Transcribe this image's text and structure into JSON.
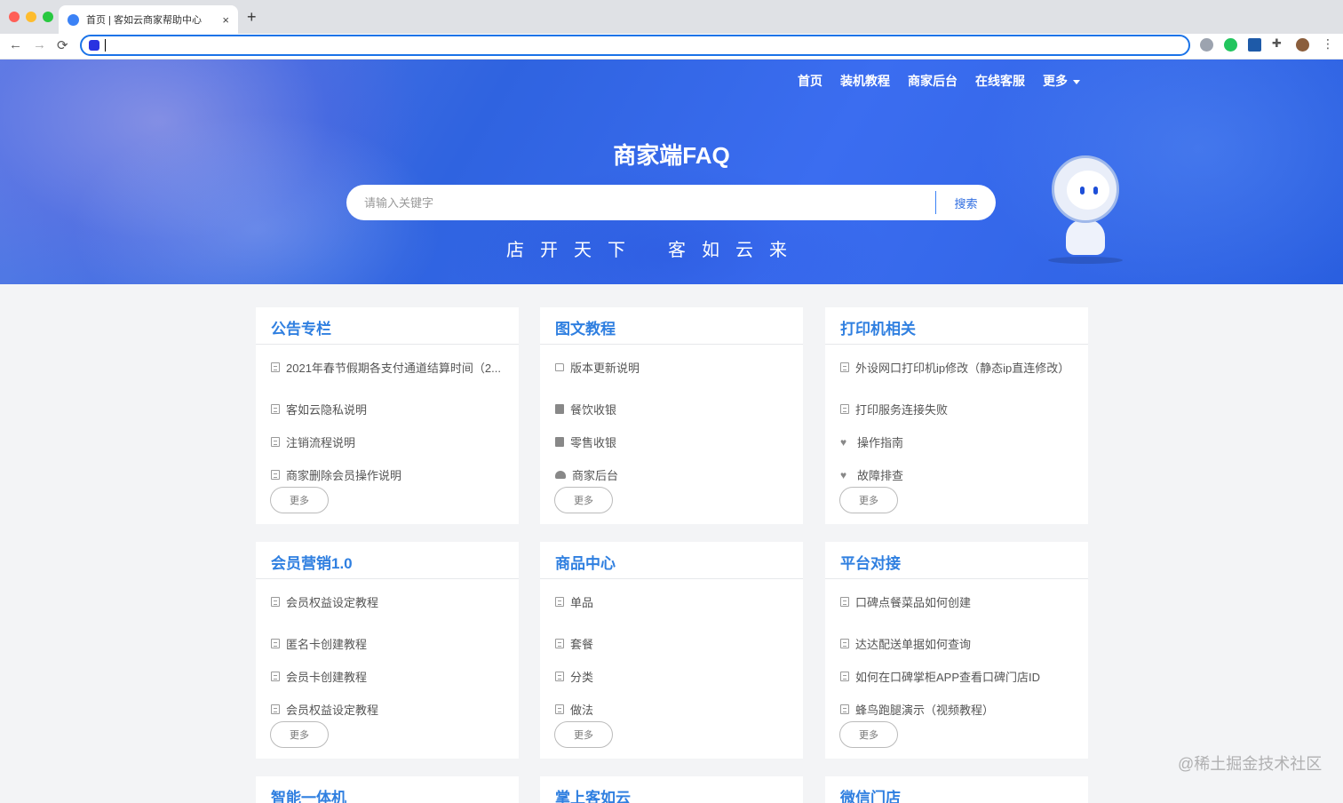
{
  "browser": {
    "tab_title": "首页 | 客如云商家帮助中心",
    "tab_close": "×",
    "new_tab": "+",
    "back": "←",
    "forward": "→",
    "reload": "⟳",
    "menu": "⋮"
  },
  "nav": {
    "items": [
      "首页",
      "装机教程",
      "商家后台",
      "在线客服"
    ],
    "more_label": "更多"
  },
  "hero": {
    "title": "商家端FAQ",
    "search_placeholder": "请输入关键字",
    "search_button": "搜索",
    "slogan_left": "店开天下",
    "slogan_right": "客如云来"
  },
  "more_label": "更多",
  "cards": [
    {
      "title": "公告专栏",
      "items": [
        {
          "icon": "doc-icon",
          "text": "2021年春节假期各支付通道结算时间（2..."
        },
        {
          "icon": "doc-icon",
          "text": "客如云隐私说明"
        },
        {
          "icon": "doc-icon",
          "text": "注销流程说明"
        },
        {
          "icon": "doc-icon",
          "text": "商家删除会员操作说明"
        }
      ]
    },
    {
      "title": "图文教程",
      "items": [
        {
          "icon": "folder-icon",
          "text": "版本更新说明"
        },
        {
          "icon": "edit-icon",
          "text": "餐饮收银"
        },
        {
          "icon": "edit-icon",
          "text": "零售收银"
        },
        {
          "icon": "cloud-icon",
          "text": "商家后台"
        }
      ]
    },
    {
      "title": "打印机相关",
      "items": [
        {
          "icon": "doc-icon",
          "text": "外设网口打印机ip修改（静态ip直连修改）"
        },
        {
          "icon": "doc-icon",
          "text": "打印服务连接失败"
        },
        {
          "icon": "heart-icon",
          "text": "操作指南"
        },
        {
          "icon": "heart-icon",
          "text": "故障排查"
        }
      ]
    },
    {
      "title": "会员营销1.0",
      "items": [
        {
          "icon": "doc-icon",
          "text": "会员权益设定教程"
        },
        {
          "icon": "doc-icon",
          "text": "匿名卡创建教程"
        },
        {
          "icon": "doc-icon",
          "text": "会员卡创建教程"
        },
        {
          "icon": "doc-icon",
          "text": "会员权益设定教程"
        }
      ]
    },
    {
      "title": "商品中心",
      "items": [
        {
          "icon": "doc-icon",
          "text": "单品"
        },
        {
          "icon": "doc-icon",
          "text": "套餐"
        },
        {
          "icon": "doc-icon",
          "text": "分类"
        },
        {
          "icon": "doc-icon",
          "text": "做法"
        }
      ]
    },
    {
      "title": "平台对接",
      "items": [
        {
          "icon": "doc-icon",
          "text": "口碑点餐菜品如何创建"
        },
        {
          "icon": "doc-icon",
          "text": "达达配送单据如何查询"
        },
        {
          "icon": "doc-icon",
          "text": "如何在口碑掌柜APP查看口碑门店ID"
        },
        {
          "icon": "doc-icon",
          "text": "蜂鸟跑腿演示（视频教程）"
        }
      ]
    }
  ],
  "partial_cards": [
    "智能一体机",
    "掌上客如云",
    "微信门店"
  ],
  "watermark": "@稀土掘金技术社区",
  "colors": {
    "accent": "#2f7fe0",
    "hero": "#2f63e0"
  }
}
